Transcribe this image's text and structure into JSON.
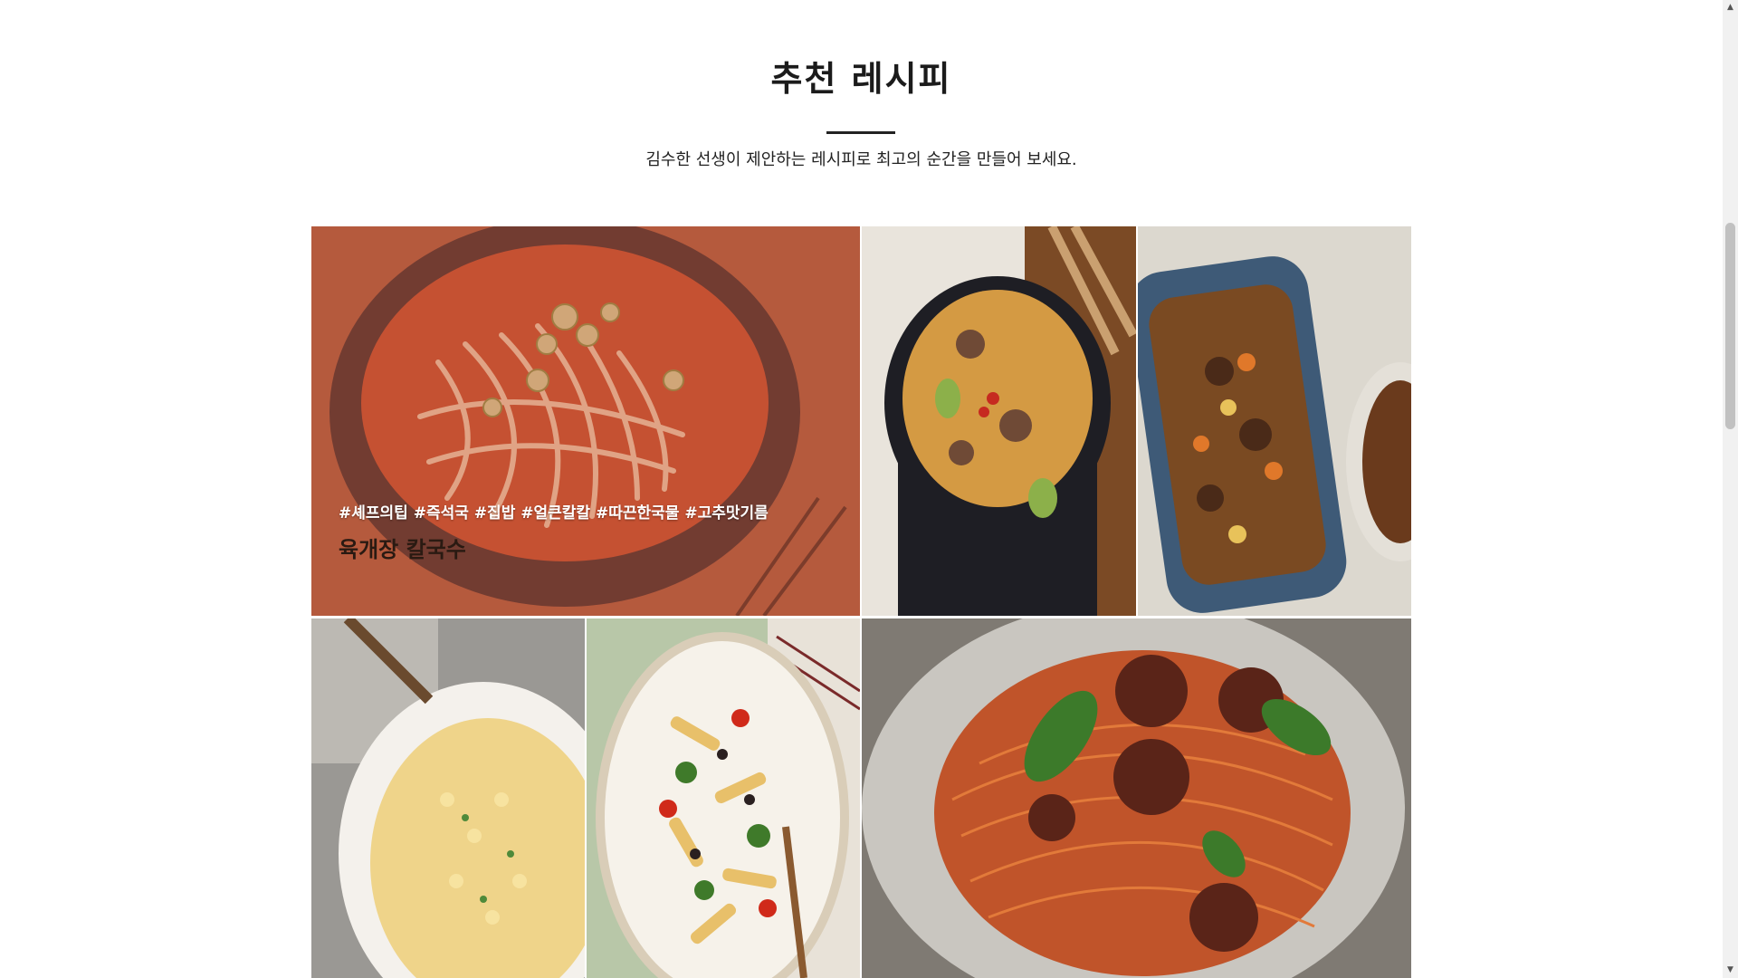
{
  "section": {
    "title": "추천 레시피",
    "subtitle": "김수한 선생이 제안하는 레시피로 최고의 순간을 만들어 보세요."
  },
  "featured": {
    "tags": "#셰프의팁 #즉석국 #집밥 #얼큰칼칼 #따끈한국물 #고추맛기름",
    "name": "육개장 칼국수"
  },
  "colors": {
    "overlay": "#c95a46",
    "accent_line": "#222222"
  },
  "icons": {
    "scroll_up": "triangle-up",
    "scroll_down": "triangle-down"
  }
}
